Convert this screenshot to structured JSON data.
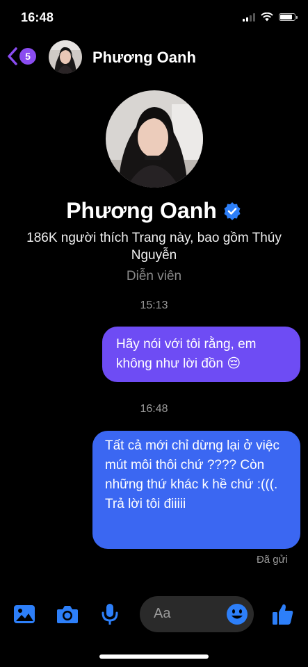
{
  "status_bar": {
    "time": "16:48"
  },
  "header": {
    "back_badge": "5",
    "name": "Phương Oanh"
  },
  "profile": {
    "name": "Phương Oanh",
    "description": "186K người thích Trang này, bao gồm Thúy Nguyễn",
    "subtitle": "Diễn viên"
  },
  "messages": [
    {
      "time": "15:13",
      "text": "Hãy nói với tôi rằng, em không như lời đồn 😔"
    },
    {
      "time": "16:48",
      "text": "Tất cả mới chỉ dừng lại ở việc mút môi thôi chứ ???? Còn những thứ khác k hề chứ :(((. Trả lời tôi điiiii"
    }
  ],
  "delivery_status": "Đã gửi",
  "composer": {
    "placeholder": "Aa"
  },
  "colors": {
    "bubble_purple": "#6e4cf4",
    "bubble_blue": "#3b67f2",
    "accent": "#2d7ff9",
    "badge": "#8a4cf0"
  }
}
